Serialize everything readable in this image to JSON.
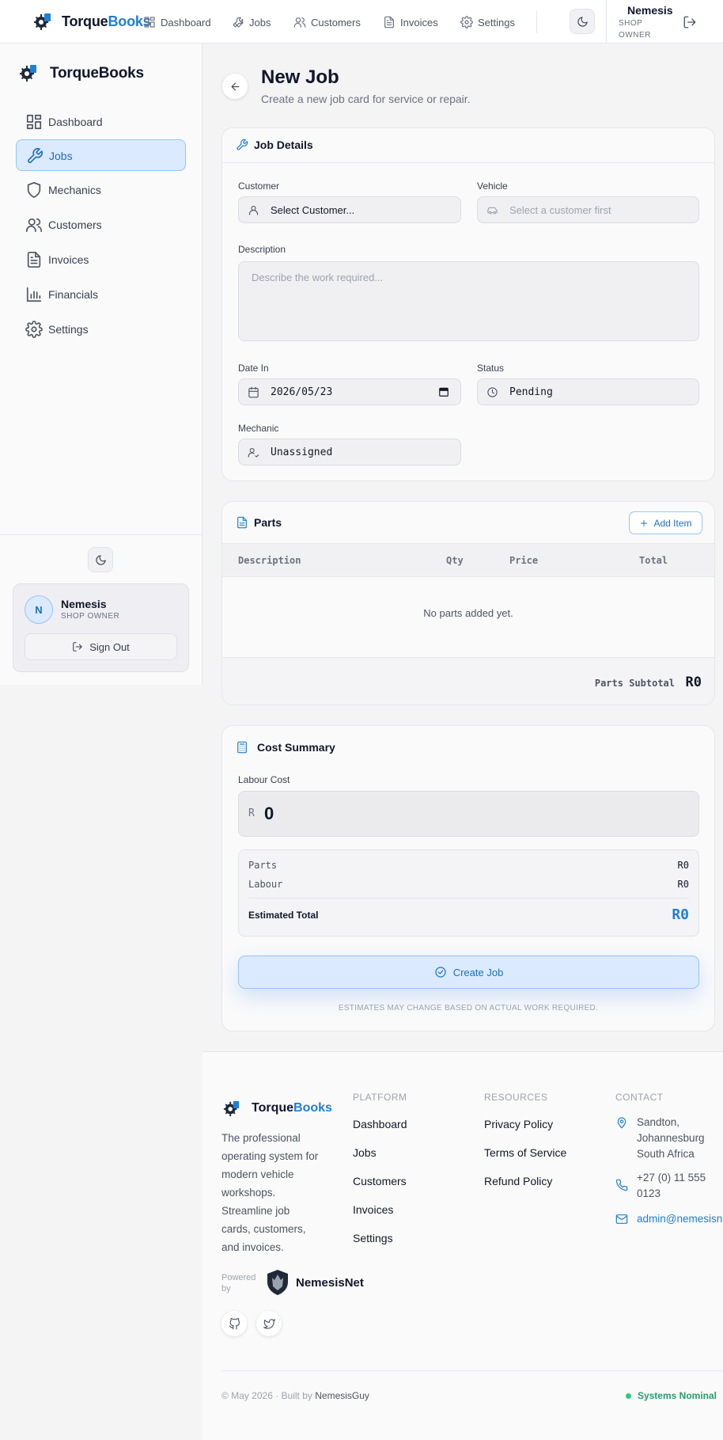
{
  "app": {
    "brand_part1": "Torque",
    "brand_part2": "Books",
    "brand_full": "TorqueBooks"
  },
  "topnav": {
    "items": [
      {
        "label": "Dashboard",
        "icon": "dashboard-icon"
      },
      {
        "label": "Jobs",
        "icon": "wrench-icon"
      },
      {
        "label": "Customers",
        "icon": "users-icon"
      },
      {
        "label": "Invoices",
        "icon": "document-icon"
      },
      {
        "label": "Settings",
        "icon": "gear-icon"
      }
    ],
    "user_name": "Nemesis",
    "user_role": "SHOP OWNER"
  },
  "sidebar": {
    "items": [
      {
        "label": "Dashboard",
        "icon": "dashboard-icon"
      },
      {
        "label": "Jobs",
        "icon": "wrench-icon",
        "active": true
      },
      {
        "label": "Mechanics",
        "icon": "shield-icon"
      },
      {
        "label": "Customers",
        "icon": "users-icon"
      },
      {
        "label": "Invoices",
        "icon": "document-icon"
      },
      {
        "label": "Financials",
        "icon": "bar-chart-icon"
      },
      {
        "label": "Settings",
        "icon": "gear-icon"
      }
    ],
    "user": {
      "initial": "N",
      "name": "Nemesis",
      "role": "SHOP OWNER"
    },
    "sign_out": "Sign Out"
  },
  "page": {
    "title": "New Job",
    "subtitle": "Create a new job card for service or repair."
  },
  "job_details": {
    "title": "Job Details",
    "customer_label": "Customer",
    "customer_value": "Select Customer...",
    "vehicle_label": "Vehicle",
    "vehicle_placeholder": "Select a customer first",
    "description_label": "Description",
    "description_placeholder": "Describe the work required...",
    "date_label": "Date In",
    "date_value": "2026/05/23",
    "status_label": "Status",
    "status_value": "Pending",
    "mechanic_label": "Mechanic",
    "mechanic_value": "Unassigned"
  },
  "parts": {
    "title": "Parts",
    "add_label": "Add Item",
    "columns": [
      "Description",
      "Qty",
      "Price",
      "Total"
    ],
    "empty_text": "No parts added yet.",
    "subtotal_label": "Parts Subtotal",
    "subtotal_value": "R0"
  },
  "cost_summary": {
    "title": "Cost Summary",
    "labour_label": "Labour Cost",
    "currency": "R",
    "labour_value": "0",
    "parts_label": "Parts",
    "parts_value": "R0",
    "labour_row_label": "Labour",
    "labour_row_value": "R0",
    "estimated_label": "Estimated Total",
    "estimated_value": "R0",
    "create_label": "Create Job",
    "disclaimer": "ESTIMATES MAY CHANGE BASED ON ACTUAL WORK REQUIRED."
  },
  "footer": {
    "about": "The professional operating system for modern vehicle workshops. Streamline job cards, customers, and invoices.",
    "platform_heading": "PLATFORM",
    "platform_links": [
      "Dashboard",
      "Jobs",
      "Customers",
      "Invoices",
      "Settings"
    ],
    "resources_heading": "RESOURCES",
    "resources_links": [
      "Privacy Policy",
      "Terms of Service",
      "Refund Policy"
    ],
    "contact_heading": "CONTACT",
    "address_line1": "Sandton,",
    "address_line2": "Johannesburg",
    "address_line3": "South Africa",
    "phone_line1": "+27 (0) 11 555",
    "phone_line2": "0123",
    "email": "admin@nemesisn",
    "powered_by": "Powered by",
    "partner_name": "NemesisNet",
    "copyright_prefix": "© May 2026 · Built by ",
    "copyright_author": "NemesisGuy",
    "status_text": "Systems Nominal"
  },
  "colors": {
    "accent": "#1e7fd6",
    "active_bg": "#dbeafe",
    "status_green": "#22a06b"
  }
}
